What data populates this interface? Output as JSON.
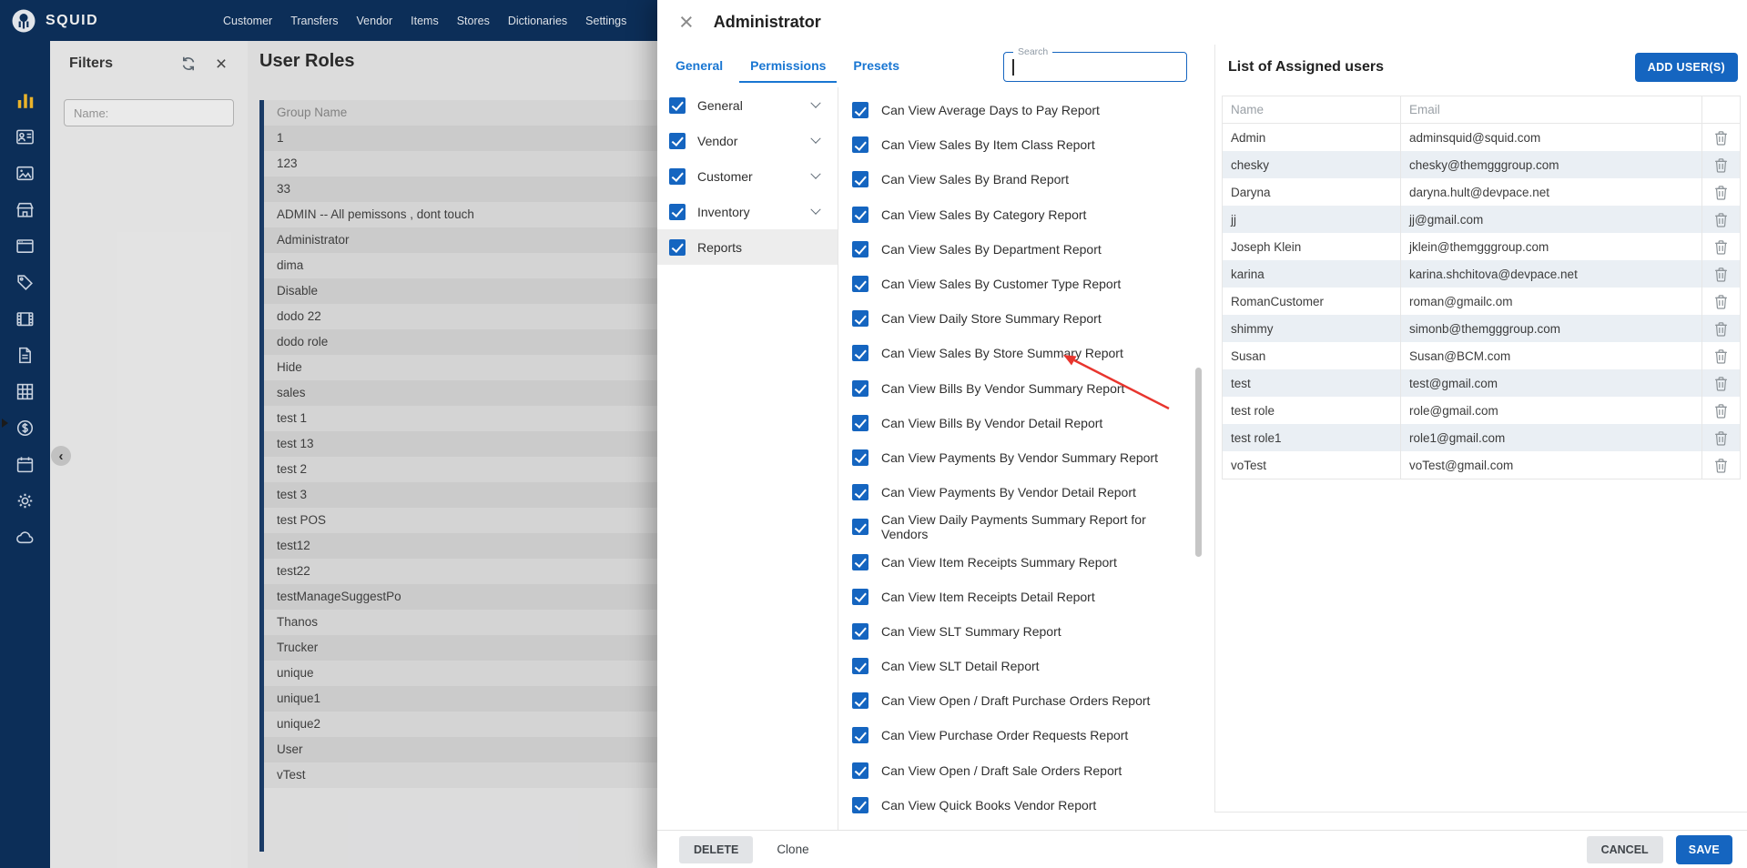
{
  "navbar": {
    "brand": "SQUID",
    "items": [
      {
        "label": "Customer"
      },
      {
        "label": "Transfers"
      },
      {
        "label": "Vendor"
      },
      {
        "label": "Items"
      },
      {
        "label": "Stores"
      },
      {
        "label": "Dictionaries"
      },
      {
        "label": "Settings"
      }
    ]
  },
  "sidebar": {
    "icons": [
      {
        "name": "equalizer-icon",
        "active": true
      },
      {
        "name": "contacts-icon",
        "active": false
      },
      {
        "name": "image-icon",
        "active": false
      },
      {
        "name": "store-icon",
        "active": false
      },
      {
        "name": "window-icon",
        "active": false
      },
      {
        "name": "tag-icon",
        "active": false
      },
      {
        "name": "film-icon",
        "active": false
      },
      {
        "name": "document-icon",
        "active": false
      },
      {
        "name": "grid-icon",
        "active": false
      },
      {
        "name": "dollar-icon",
        "active": false
      },
      {
        "name": "calendar-icon",
        "active": false
      },
      {
        "name": "gear-icon",
        "active": false
      },
      {
        "name": "cloud-icon",
        "active": false
      }
    ]
  },
  "filters": {
    "title": "Filters",
    "icons": [
      "refresh-icon",
      "close-icon"
    ],
    "name_placeholder": "Name:"
  },
  "user_roles": {
    "title": "User Roles",
    "column_header": "Group Name",
    "rows": [
      "1",
      "123",
      "33",
      "ADMIN -- All pemissons , dont touch",
      "Administrator",
      "dima",
      "Disable",
      "dodo 22",
      "dodo role",
      "Hide",
      "sales",
      "test 1",
      "test 13",
      "test 2",
      "test 3",
      "test POS",
      "test12",
      "test22",
      "testManageSuggestPo",
      "Thanos",
      "Trucker",
      "unique",
      "unique1",
      "unique2",
      "User",
      "vTest"
    ]
  },
  "modal": {
    "title": "Administrator",
    "tabs": [
      {
        "label": "General",
        "active": false
      },
      {
        "label": "Permissions",
        "active": true
      },
      {
        "label": "Presets",
        "active": false
      }
    ],
    "search_label": "Search",
    "categories": [
      {
        "label": "General",
        "checked": true,
        "expandable": true,
        "selected": false
      },
      {
        "label": "Vendor",
        "checked": true,
        "expandable": true,
        "selected": false
      },
      {
        "label": "Customer",
        "checked": true,
        "expandable": true,
        "selected": false
      },
      {
        "label": "Inventory",
        "checked": true,
        "expandable": true,
        "selected": false
      },
      {
        "label": "Reports",
        "checked": true,
        "expandable": false,
        "selected": true
      }
    ],
    "permissions": [
      "Can View Average Days to Pay Report",
      "Can View Sales By Item Class Report",
      "Can View Sales By Brand Report",
      "Can View Sales By Category Report",
      "Can View Sales By Department Report",
      "Can View Sales By Customer Type Report",
      "Can View Daily Store Summary Report",
      "Can View Sales By Store Summary Report",
      "Can View Bills By Vendor Summary Report",
      "Can View Bills By Vendor Detail Report",
      "Can View Payments By Vendor Summary Report",
      "Can View Payments By Vendor Detail Report",
      "Can View Daily Payments Summary Report for Vendors",
      "Can View Item Receipts Summary Report",
      "Can View Item Receipts Detail Report",
      "Can View SLT Summary Report",
      "Can View SLT Detail Report",
      "Can View Open / Draft Purchase Orders Report",
      "Can View Purchase Order Requests Report",
      "Can View Open / Draft Sale Orders Report",
      "Can View Quick Books Vendor Report"
    ],
    "assigned_users": {
      "title": "List of Assigned users",
      "add_button": "ADD USER(S)",
      "columns": [
        "Name",
        "Email"
      ],
      "rows": [
        {
          "name": "Admin",
          "email": "adminsquid@squid.com"
        },
        {
          "name": "chesky",
          "email": "chesky@themgggroup.com"
        },
        {
          "name": "Daryna",
          "email": "daryna.hult@devpace.net"
        },
        {
          "name": "jj",
          "email": "jj@gmail.com"
        },
        {
          "name": "Joseph Klein",
          "email": "jklein@themgggroup.com"
        },
        {
          "name": "karina",
          "email": "karina.shchitova@devpace.net"
        },
        {
          "name": "RomanCustomer",
          "email": "roman@gmailc.om"
        },
        {
          "name": "shimmy",
          "email": "simonb@themgggroup.com"
        },
        {
          "name": "Susan",
          "email": "Susan@BCM.com"
        },
        {
          "name": "test",
          "email": "test@gmail.com"
        },
        {
          "name": "test role",
          "email": "role@gmail.com"
        },
        {
          "name": "test role1",
          "email": "role1@gmail.com"
        },
        {
          "name": "voTest",
          "email": "voTest@gmail.com"
        }
      ]
    },
    "footer": {
      "delete": "DELETE",
      "clone": "Clone",
      "cancel": "CANCEL",
      "save": "SAVE"
    }
  },
  "colors": {
    "navbar": "#0c315e",
    "accent": "#1565c0",
    "tab_blue": "#1976d2",
    "highlight_yellow": "#fbc02d",
    "arrow_red": "#e8352e"
  }
}
